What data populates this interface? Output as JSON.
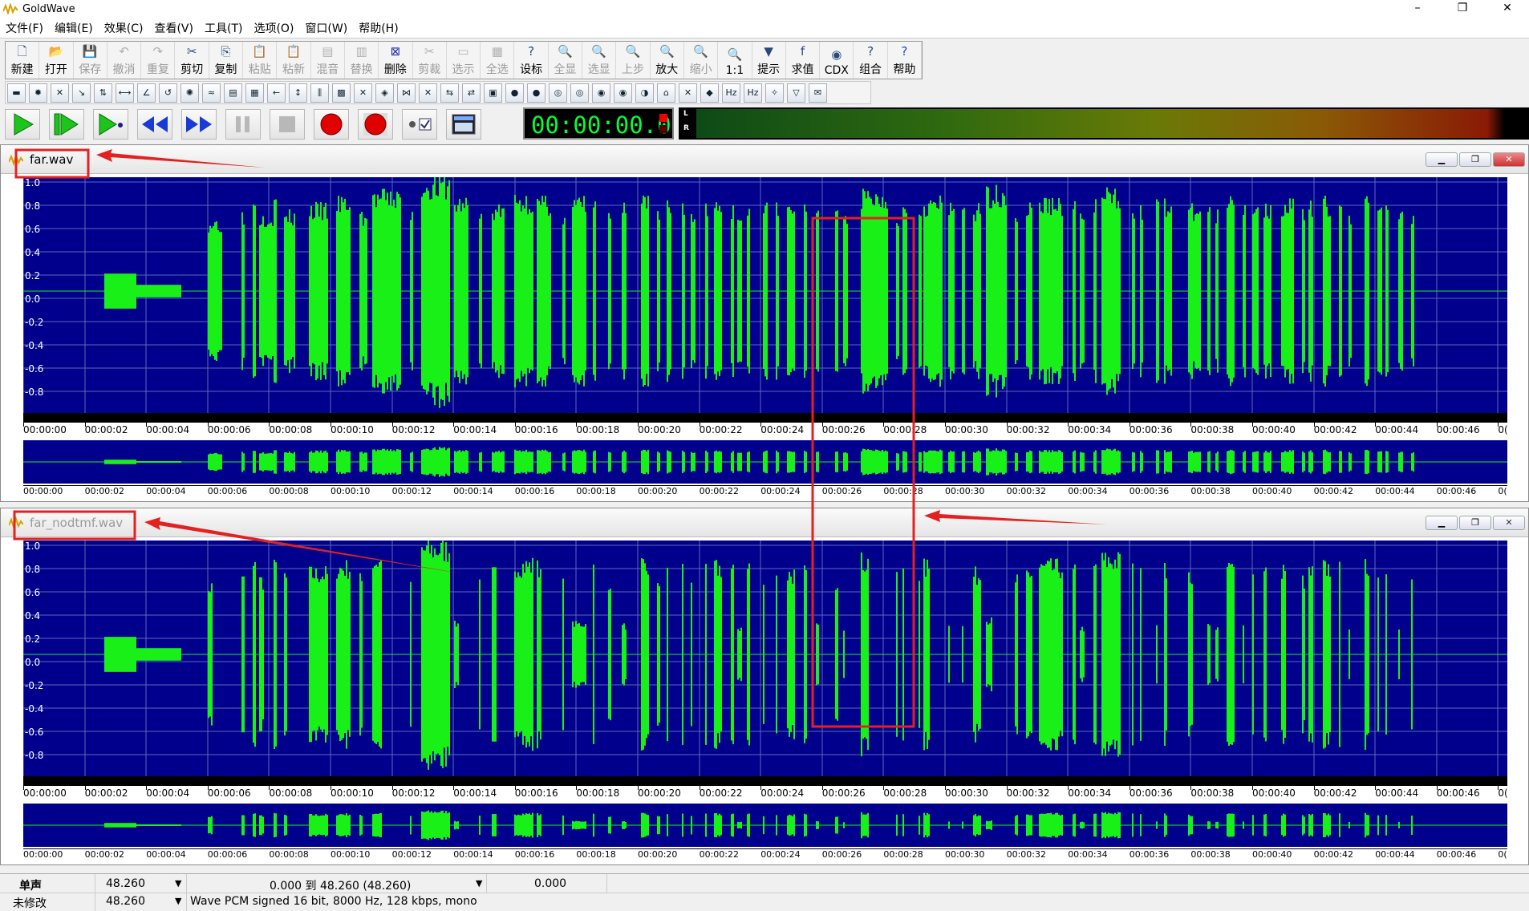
{
  "app": {
    "title": "GoldWave"
  },
  "window": {
    "minimize": "–",
    "maximize": "❐",
    "close": "✕"
  },
  "menu": [
    "文件(F)",
    "编辑(E)",
    "效果(C)",
    "查看(V)",
    "工具(T)",
    "选项(O)",
    "窗口(W)",
    "帮助(H)"
  ],
  "toolbar": [
    {
      "label": "新建",
      "icon": "new-file-icon",
      "enabled": true
    },
    {
      "label": "打开",
      "icon": "open-folder-icon",
      "enabled": true
    },
    {
      "label": "保存",
      "icon": "save-icon",
      "enabled": false
    },
    {
      "label": "撤消",
      "icon": "undo-icon",
      "enabled": false
    },
    {
      "label": "重复",
      "icon": "redo-icon",
      "enabled": false
    },
    {
      "label": "剪切",
      "icon": "scissors-icon",
      "enabled": true
    },
    {
      "label": "复制",
      "icon": "copy-icon",
      "enabled": true
    },
    {
      "label": "粘贴",
      "icon": "paste-icon",
      "enabled": false
    },
    {
      "label": "粘新",
      "icon": "paste-new-icon",
      "enabled": false
    },
    {
      "label": "混音",
      "icon": "mix-icon",
      "enabled": false
    },
    {
      "label": "替换",
      "icon": "replace-icon",
      "enabled": false
    },
    {
      "label": "删除",
      "icon": "delete-icon",
      "enabled": true
    },
    {
      "label": "剪裁",
      "icon": "trim-icon",
      "enabled": false
    },
    {
      "label": "选示",
      "icon": "select-view-icon",
      "enabled": false
    },
    {
      "label": "全选",
      "icon": "select-all-icon",
      "enabled": false
    },
    {
      "label": "设标",
      "icon": "set-marker-icon",
      "enabled": true
    },
    {
      "label": "全显",
      "icon": "show-all-icon",
      "enabled": false
    },
    {
      "label": "选显",
      "icon": "zoom-selection-icon",
      "enabled": false
    },
    {
      "label": "上步",
      "icon": "previous-view-icon",
      "enabled": false
    },
    {
      "label": "放大",
      "icon": "zoom-in-icon",
      "enabled": true
    },
    {
      "label": "缩小",
      "icon": "zoom-out-icon",
      "enabled": false
    },
    {
      "label": "1:1",
      "icon": "zoom-1to1-icon",
      "enabled": true
    },
    {
      "label": "提示",
      "icon": "cue-points-icon",
      "enabled": true
    },
    {
      "label": "求值",
      "icon": "expression-icon",
      "enabled": true
    },
    {
      "label": "CDX",
      "icon": "cd-extract-icon",
      "enabled": true
    },
    {
      "label": "组合",
      "icon": "combine-icon",
      "enabled": true
    },
    {
      "label": "帮助",
      "icon": "help-icon",
      "enabled": true
    }
  ],
  "effects_toolbar_count": 38,
  "transport": {
    "time": "00:00:00.0",
    "vu_left": "L",
    "vu_right": "R"
  },
  "ylabels": [
    "1.0",
    "0.8",
    "0.6",
    "0.4",
    "0.2",
    "0.0",
    "-0.2",
    "-0.4",
    "-0.6",
    "-0.8"
  ],
  "time_labels": [
    "00:00:00",
    "00:00:02",
    "00:00:04",
    "00:00:06",
    "00:00:08",
    "00:00:10",
    "00:00:12",
    "00:00:14",
    "00:00:16",
    "00:00:18",
    "00:00:20",
    "00:00:22",
    "00:00:24",
    "00:00:26",
    "00:00:28",
    "00:00:30",
    "00:00:32",
    "00:00:34",
    "00:00:36",
    "00:00:38",
    "00:00:40",
    "00:00:42",
    "00:00:44",
    "00:00:46",
    "0("
  ],
  "files": [
    {
      "name": "far.wav",
      "active": true
    },
    {
      "name": "far_nodtmf.wav",
      "active": false
    }
  ],
  "colors": {
    "wave_bg": "#00008c",
    "wave": "#18f018",
    "annotation": "#e52020"
  },
  "status": {
    "channel": "单声",
    "length": "48.260",
    "selection": "0.000 到 48.260 (48.260)",
    "position": "0.000",
    "modified": "未修改",
    "length2": "48.260",
    "format": "Wave PCM signed 16 bit, 8000 Hz, 128 kbps, mono"
  }
}
